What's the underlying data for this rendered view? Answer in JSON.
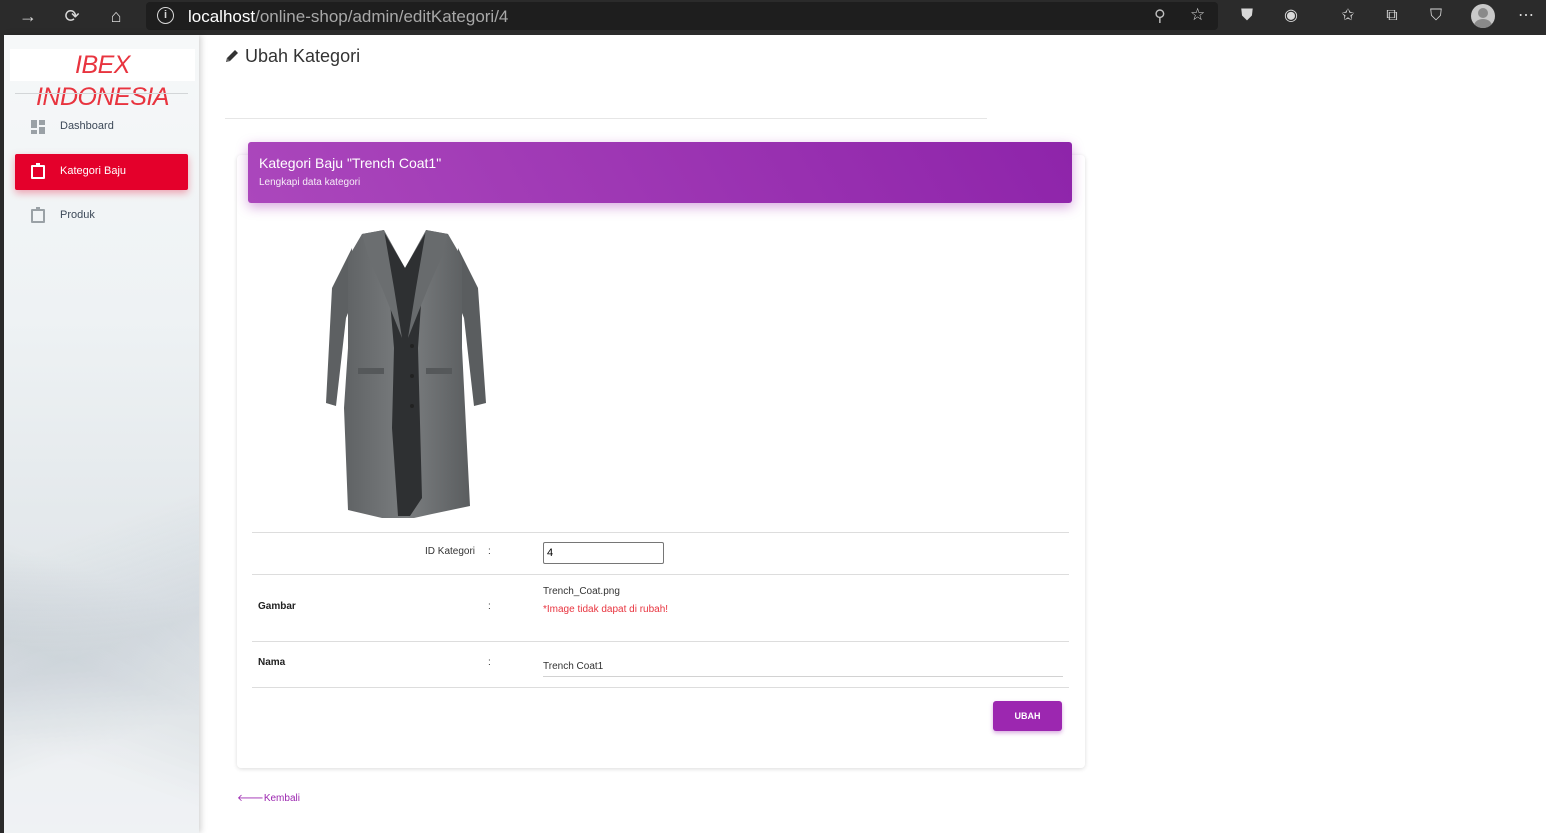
{
  "browser": {
    "url_host": "localhost",
    "url_path": "/online-shop/admin/editKategori/4"
  },
  "sidebar": {
    "logo": "IBEX INDONESIA",
    "items": [
      {
        "label": "Dashboard",
        "icon": "dashboard-icon",
        "active": false
      },
      {
        "label": "Kategori Baju",
        "icon": "clipboard-icon",
        "active": true
      },
      {
        "label": "Produk",
        "icon": "clipboard-icon",
        "active": false
      }
    ]
  },
  "page": {
    "title": "Ubah Kategori"
  },
  "card": {
    "title": "Kategori Baju \"Trench Coat1\"",
    "subtitle": "Lengkapi data kategori",
    "image_alt": "coat-image"
  },
  "form": {
    "id_label": "ID Kategori",
    "id_value": "4",
    "colon": ":",
    "gambar_label": "Gambar",
    "gambar_file": "Trench_Coat.png",
    "gambar_warning": "*Image tidak dapat di rubah!",
    "nama_label": "Nama",
    "nama_value": "Trench Coat1",
    "submit_label": "UBAH"
  },
  "back_link": "Kembali",
  "colors": {
    "accent_purple": "#9c27b0",
    "active_red": "#e4002b",
    "logo_red": "#e8343f"
  }
}
